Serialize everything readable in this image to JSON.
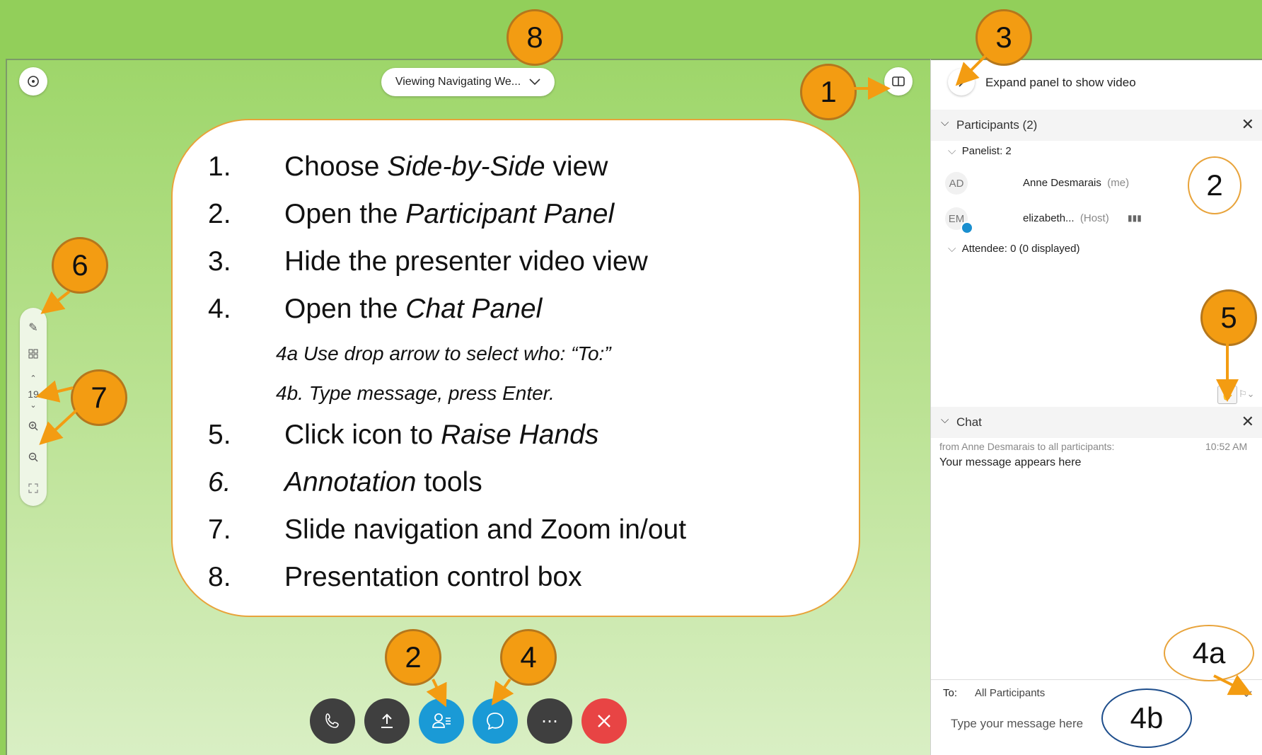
{
  "header": {
    "viewing_label": "Viewing Navigating We...",
    "expand_panel_label": "Expand panel to show video"
  },
  "instructions": {
    "steps": [
      {
        "num": "1.",
        "pre": "Choose ",
        "em": "Side-by-Side",
        "post": " view"
      },
      {
        "num": "2.",
        "pre": "Open the ",
        "em": "Participant Panel",
        "post": ""
      },
      {
        "num": "3.",
        "pre": "Hide the presenter video view",
        "em": "",
        "post": ""
      },
      {
        "num": "4.",
        "pre": "Open the ",
        "em": "Chat Panel",
        "post": ""
      },
      {
        "num": "5.",
        "pre": "Click icon to ",
        "em": "Raise Hands",
        "post": ""
      },
      {
        "num": "6.",
        "pre": "",
        "em": "Annotation",
        "post": " tools"
      },
      {
        "num": "7.",
        "pre": "Slide navigation and Zoom in/out",
        "em": "",
        "post": ""
      },
      {
        "num": "8.",
        "pre": "Presentation control box",
        "em": "",
        "post": ""
      }
    ],
    "sub_4a": "4a Use drop arrow to select who: “To:”",
    "sub_4b": "4b. Type message, press Enter."
  },
  "badges": {
    "b1": "1",
    "b2_panel": "2",
    "b2_bottom": "2",
    "b3": "3",
    "b4": "4",
    "b4a": "4a",
    "b4b": "4b",
    "b5": "5",
    "b6": "6",
    "b7": "7",
    "b8": "8"
  },
  "toolbar": {
    "page_number": "19"
  },
  "participants": {
    "title": "Participants (2)",
    "panelist_group": "Panelist: 2",
    "attendee_group": "Attendee: 0 (0 displayed)",
    "people": [
      {
        "initials": "AD",
        "name": "Anne Desmarais",
        "tag": "(me)"
      },
      {
        "initials": "EM",
        "name": "elizabeth...",
        "tag": "(Host)"
      }
    ]
  },
  "chat": {
    "title": "Chat",
    "from": "from Anne Desmarais to all participants:",
    "time": "10:52 AM",
    "message": "Your message appears here",
    "to_label": "To:",
    "to_value": "All Participants",
    "input_placeholder": "Type your message here"
  },
  "colors": {
    "badge_orange": "#f39c12",
    "background_green": "#92cf5a",
    "button_blue": "#1a9ad6",
    "button_dark": "#3f3f3f",
    "button_red": "#e84444"
  }
}
